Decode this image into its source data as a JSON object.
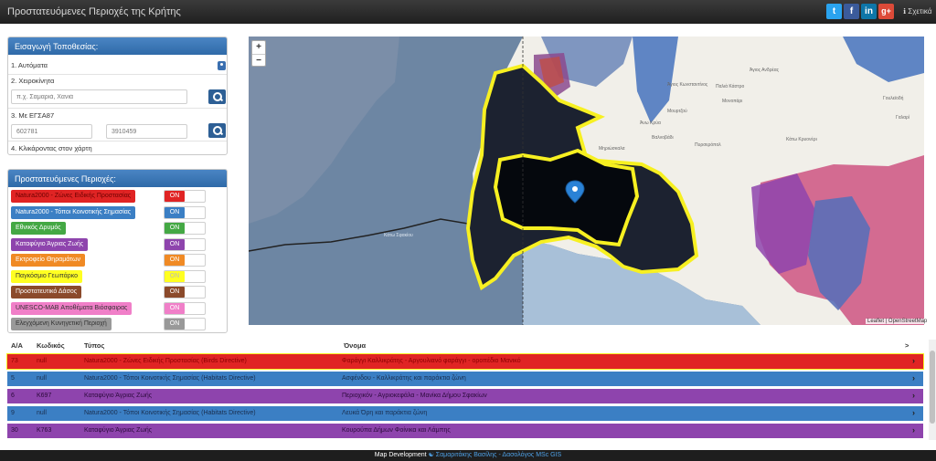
{
  "app": {
    "title": "Προστατευόμενες Περιοχές της Κρήτης",
    "about": "ℹ Σχετικά"
  },
  "social": {
    "twitter": "t",
    "facebook": "f",
    "linkedin": "in",
    "google": "g+"
  },
  "location_panel": {
    "title": "Εισαγωγή Τοποθεσίας:",
    "auto_label": "1. Αυτόματα",
    "manual_label": "2. Χειροκίνητα",
    "manual_placeholder": "π.χ. Σαμαριά, Χανιά",
    "egsa_label": "3. Με ΕΓΣΑ87",
    "egsa_x": "602781",
    "egsa_y": "3910459",
    "click_label": "4. Κλικάροντας στον χάρτη"
  },
  "areas_panel": {
    "title": "Προστατευόμενες Περιοχές:",
    "items": [
      {
        "label": "Natura2000 - Ζώνες Ειδικής Προστασίας",
        "toggle": "ON",
        "color": "#e02424"
      },
      {
        "label": "Natura2000 - Τόποι Κοινοτικής Σημασίας",
        "toggle": "ON",
        "color": "#3b7fc4"
      },
      {
        "label": "Εθνικός Δρυμός",
        "toggle": "ON",
        "color": "#44a844"
      },
      {
        "label": "Καταφύγιο Άγριας Ζωής",
        "toggle": "ON",
        "color": "#8e44ad"
      },
      {
        "label": "Εκτροφείο Θηραμάτων",
        "toggle": "ON",
        "color": "#f08a24"
      },
      {
        "label": "Παγκόσμιο Γεωπάρκο",
        "toggle": "ON",
        "color": "#ffff22"
      },
      {
        "label": "Προστατευτικό Δάσος",
        "toggle": "ON",
        "color": "#8b4a2b"
      },
      {
        "label": "UNESCO-MAB Αποθέματα Βιόσφαιρας",
        "toggle": "ON",
        "color": "#f07fc8"
      },
      {
        "label": "Ελεγχόμενη Κυνηγετική Περιοχή",
        "toggle": "ON",
        "color": "#999999"
      }
    ]
  },
  "map": {
    "zoom_in": "+",
    "zoom_out": "−",
    "attribution": "Leaflet | OpenStreetMap",
    "place_labels": [
      "Άγιος Ανδρέας",
      "Άγιος Κωνσταντίνος",
      "Παλιά Κάστρο",
      "Μονοπάρι",
      "Μουρτζού",
      "Άνω Κρύα",
      "Βαλνοβάδι",
      "Πυρσερόπολ",
      "Μηριώσκαλα",
      "Κάτω Κρυονέρι",
      "Γουλεϊοδή",
      "Γαλαρί",
      "Κάτω Σφακίου"
    ]
  },
  "table": {
    "headers": {
      "aa": "Α/Α",
      "code": "Κωδικός",
      "type": "Τύπος",
      "name": "Όνομα",
      "more": ">"
    },
    "rows": [
      {
        "aa": "73",
        "code": "null",
        "type": "Natura2000 - Ζώνες Ειδικής Προστασίας (Birds Directive)",
        "name": "Φαράγγι Καλλικράτης - Αργουλιανό φαράγγι - οροπέδιο Μανικό",
        "color": "#e02424",
        "text_color": "#8b0000"
      },
      {
        "aa": "5",
        "code": "null",
        "type": "Natura2000 - Τόποι Κοινοτικής Σημασίας (Habitats Directive)",
        "name": "Ασφένδου - Καλλικράτης και παράκτια ζώνη",
        "color": "#3b7fc4",
        "text_color": "#1a2f4f"
      },
      {
        "aa": "6",
        "code": "K697",
        "type": "Καταφύγιο Άγριας Ζωής",
        "name": "Περιοχικόν - Αγριοκεφάλα - Μανίκα Δήμου Σφακίων",
        "color": "#8e44ad",
        "text_color": "#2b0a3b"
      },
      {
        "aa": "9",
        "code": "null",
        "type": "Natura2000 - Τόποι Κοινοτικής Σημασίας (Habitats Directive)",
        "name": "Λευκά Όρη και παράκτια ζώνη",
        "color": "#3b7fc4",
        "text_color": "#1a2f4f"
      },
      {
        "aa": "30",
        "code": "K763",
        "type": "Καταφύγιο Άγριας Ζωής",
        "name": "Κουρούπα Δήμων Φοίνικα και Λάμπης",
        "color": "#8e44ad",
        "text_color": "#2b0a3b"
      }
    ]
  },
  "footer": {
    "prefix": "Map Development",
    "author": "☯ Σαμαριτάκης Βασίλης - Δασολόγος MSc GIS"
  }
}
